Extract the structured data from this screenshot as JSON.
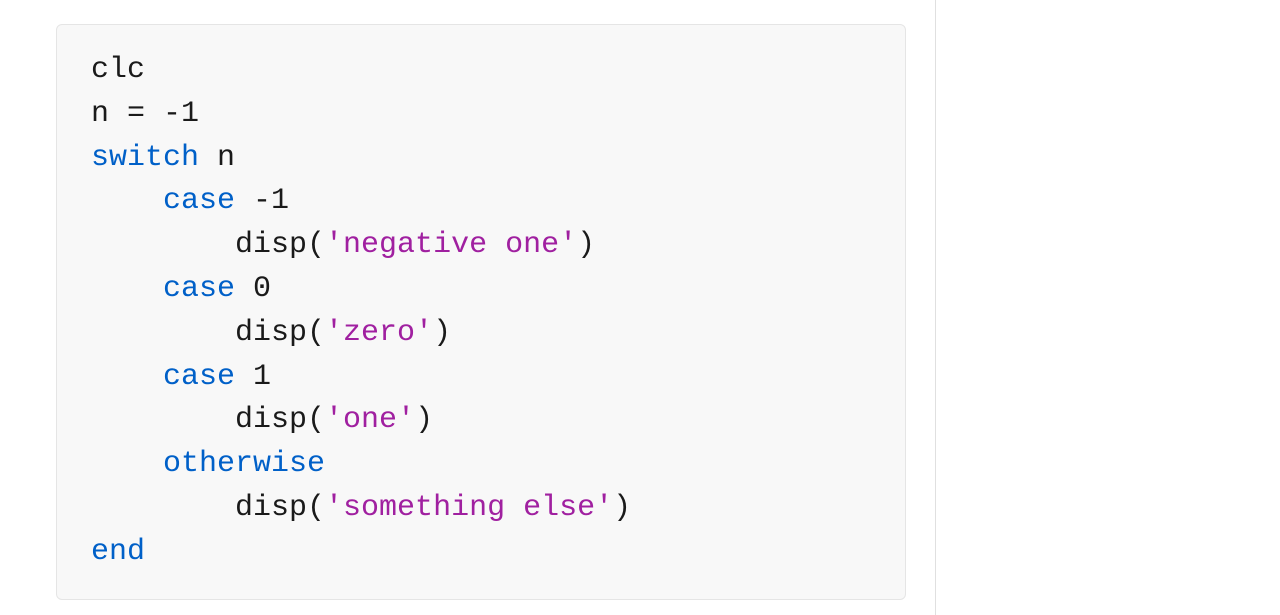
{
  "code": {
    "line1": "clc",
    "line2_var": "n = ",
    "line2_val": "-1",
    "line3_kw": "switch",
    "line3_rest": " n",
    "case1_kw": "case",
    "case1_rest": " -1",
    "case1_disp_pre": "disp(",
    "case1_disp_str": "'negative one'",
    "case1_disp_post": ")",
    "case2_kw": "case",
    "case2_rest": " 0",
    "case2_disp_pre": "disp(",
    "case2_disp_str": "'zero'",
    "case2_disp_post": ")",
    "case3_kw": "case",
    "case3_rest": " 1",
    "case3_disp_pre": "disp(",
    "case3_disp_str": "'one'",
    "case3_disp_post": ")",
    "otherwise_kw": "otherwise",
    "otherwise_disp_pre": "disp(",
    "otherwise_disp_str": "'something else'",
    "otherwise_disp_post": ")",
    "end_kw": "end"
  },
  "indent1": "    ",
  "indent2": "        "
}
